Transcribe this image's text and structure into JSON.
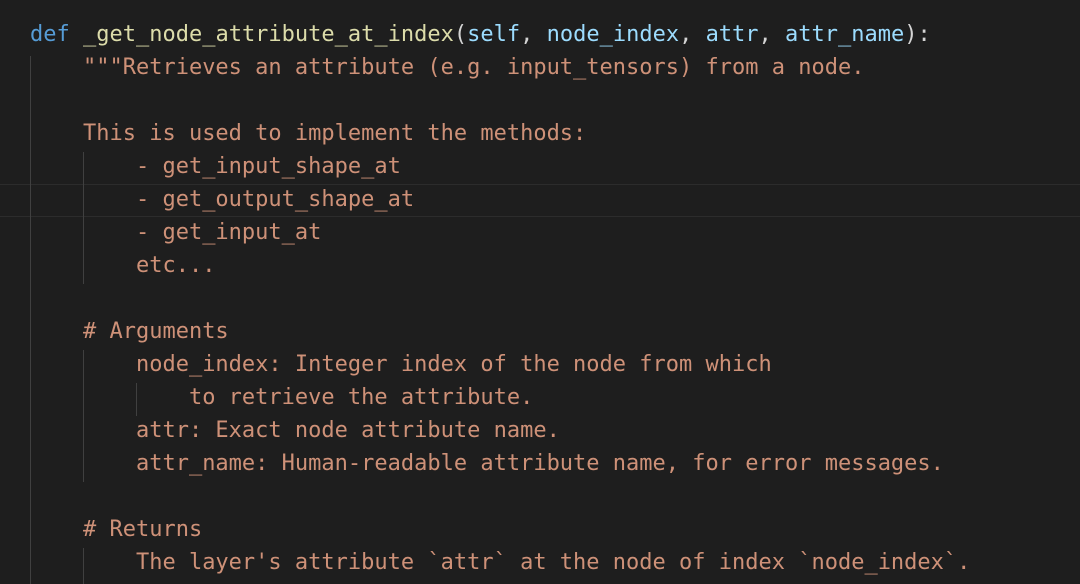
{
  "code": {
    "signature": {
      "keyword": "def",
      "function_name": "_get_node_attribute_at_index",
      "open_paren": "(",
      "params": [
        "self",
        "node_index",
        "attr",
        "attr_name"
      ],
      "separator": ", ",
      "close": "):"
    },
    "docstring_lines": [
      "\"\"\"Retrieves an attribute (e.g. input_tensors) from a node.",
      "",
      "This is used to implement the methods:",
      "    - get_input_shape_at",
      "    - get_output_shape_at",
      "    - get_input_at",
      "    etc...",
      "",
      "# Arguments",
      "    node_index: Integer index of the node from which",
      "        to retrieve the attribute.",
      "    attr: Exact node attribute name.",
      "    attr_name: Human-readable attribute name, for error messages.",
      "",
      "# Returns",
      "    The layer's attribute `attr` at the node of index `node_index`."
    ]
  },
  "colors": {
    "background": "#1e1e1e",
    "keyword": "#569cd6",
    "function": "#dcdcaa",
    "parameter": "#9cdcfe",
    "string": "#ce9178",
    "punctuation": "#d4d4d4"
  }
}
